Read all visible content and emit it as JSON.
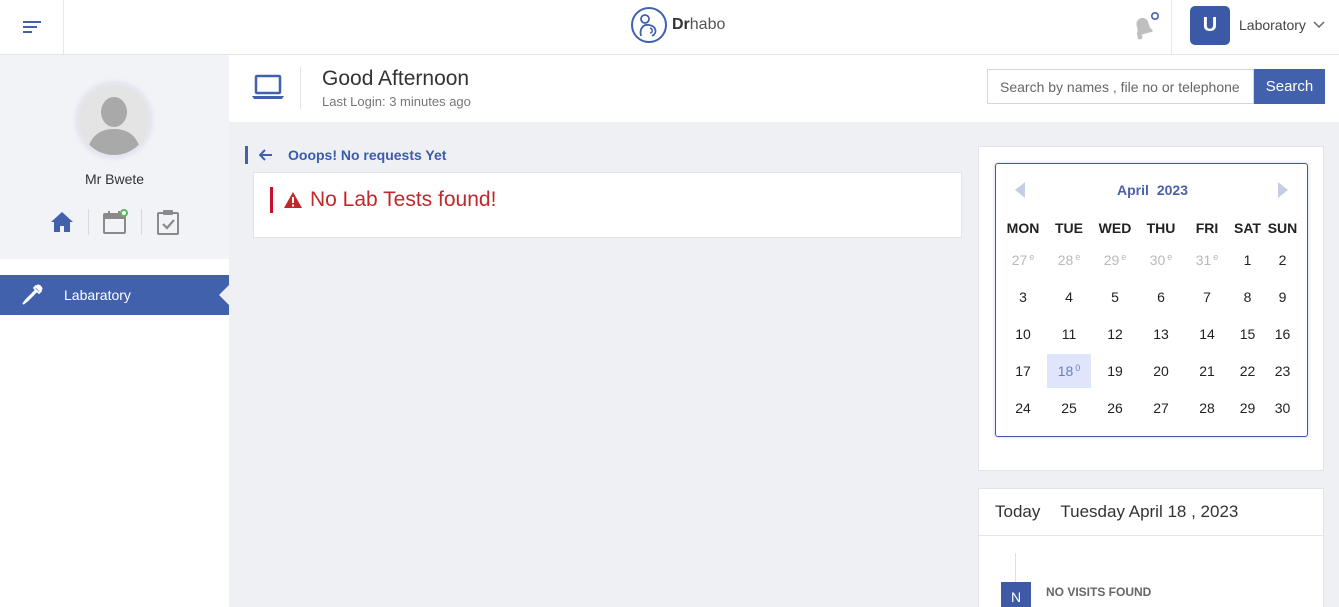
{
  "app": {
    "logo_prefix": "Dr",
    "logo_suffix": "habo",
    "notification_count": "0"
  },
  "user": {
    "initial": "U",
    "role": "Laboratory"
  },
  "profile": {
    "name": "Mr Bwete"
  },
  "sidebar": {
    "items": [
      {
        "label": "Labaratory",
        "icon": "pipette-icon",
        "active": true
      }
    ]
  },
  "header": {
    "greeting": "Good Afternoon",
    "last_login": "Last Login: 3 minutes ago"
  },
  "search": {
    "placeholder": "Search by names , file no or telephone",
    "button_label": "Search"
  },
  "requests": {
    "title": "Ooops! No requests Yet",
    "alert": "No Lab Tests found!",
    "alert_color": "#c0282b"
  },
  "calendar": {
    "month": "April",
    "year": "2023",
    "weekdays": [
      "MON",
      "TUE",
      "WED",
      "THU",
      "FRI",
      "SAT",
      "SUN"
    ],
    "weeks": [
      [
        {
          "d": "27",
          "sup": "e",
          "other": true
        },
        {
          "d": "28",
          "sup": "e",
          "other": true
        },
        {
          "d": "29",
          "sup": "e",
          "other": true
        },
        {
          "d": "30",
          "sup": "e",
          "other": true
        },
        {
          "d": "31",
          "sup": "e",
          "other": true
        },
        {
          "d": "1"
        },
        {
          "d": "2"
        }
      ],
      [
        {
          "d": "3"
        },
        {
          "d": "4"
        },
        {
          "d": "5"
        },
        {
          "d": "6"
        },
        {
          "d": "7"
        },
        {
          "d": "8"
        },
        {
          "d": "9"
        }
      ],
      [
        {
          "d": "10"
        },
        {
          "d": "11"
        },
        {
          "d": "12"
        },
        {
          "d": "13"
        },
        {
          "d": "14"
        },
        {
          "d": "15"
        },
        {
          "d": "16"
        }
      ],
      [
        {
          "d": "17"
        },
        {
          "d": "18",
          "sup": "0",
          "today": true
        },
        {
          "d": "19"
        },
        {
          "d": "20"
        },
        {
          "d": "21"
        },
        {
          "d": "22"
        },
        {
          "d": "23"
        }
      ],
      [
        {
          "d": "24"
        },
        {
          "d": "25"
        },
        {
          "d": "26"
        },
        {
          "d": "27"
        },
        {
          "d": "28"
        },
        {
          "d": "29"
        },
        {
          "d": "30"
        }
      ]
    ]
  },
  "today": {
    "label": "Today",
    "date": "Tuesday April 18 , 2023",
    "badge": "N",
    "empty_text": "NO VISITS FOUND"
  },
  "colors": {
    "accent": "#4161ad",
    "alert": "#c0282b",
    "today_bg": "#dfe6fb"
  }
}
